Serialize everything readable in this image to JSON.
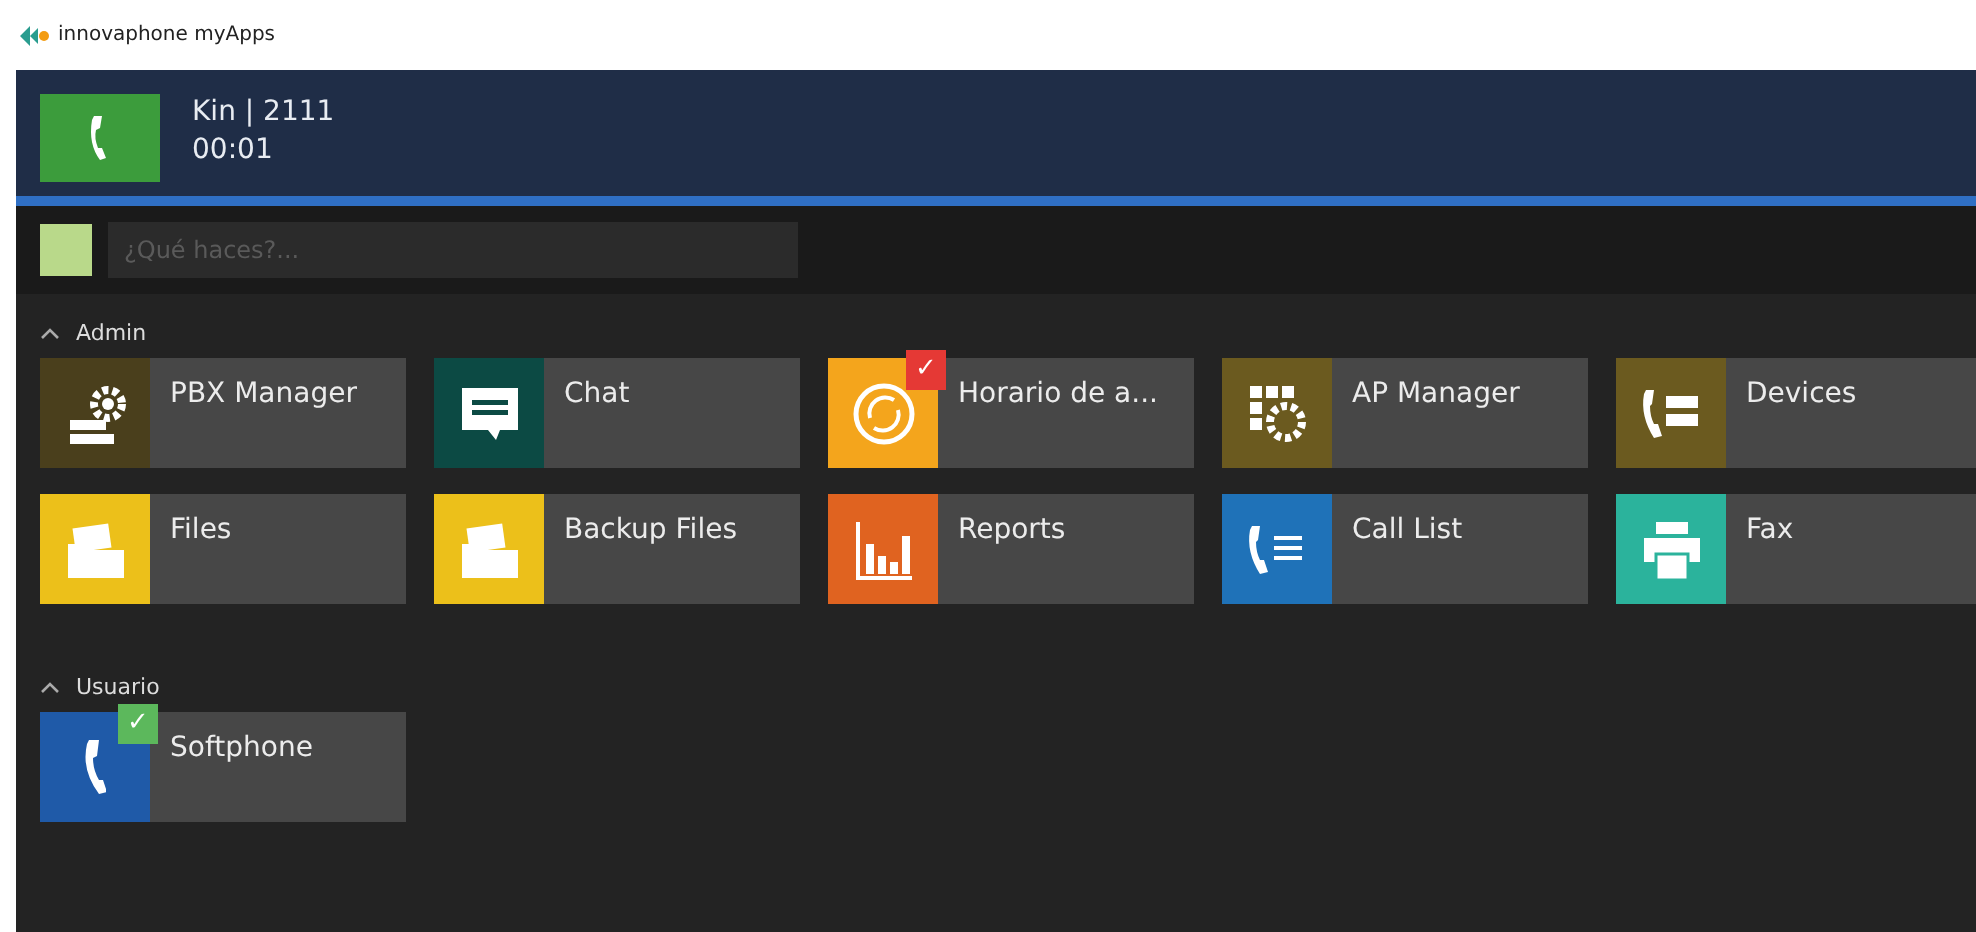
{
  "window": {
    "title": "innovaphone myApps"
  },
  "call": {
    "name": "Kin | 2111",
    "duration": "00:01"
  },
  "status": {
    "placeholder": "¿Qué haces?..."
  },
  "sections": [
    {
      "title": "Admin",
      "expanded": true,
      "apps": [
        {
          "label": "PBX Manager",
          "kind": "server-gear",
          "color": "#4a3f1c"
        },
        {
          "label": "Chat",
          "kind": "chat",
          "color": "#0c4a44"
        },
        {
          "label": "Horario de a...",
          "kind": "clock",
          "color": "#f4a51c",
          "badge": {
            "mark": "✓",
            "color": "#e53935"
          }
        },
        {
          "label": "AP Manager",
          "kind": "grid-gear",
          "color": "#6b5a1f"
        },
        {
          "label": "Devices",
          "kind": "phone-server",
          "color": "#6b5a1f"
        },
        {
          "label": "Files",
          "kind": "folder",
          "color": "#ecc01a"
        },
        {
          "label": "Backup Files",
          "kind": "folder",
          "color": "#ecc01a"
        },
        {
          "label": "Reports",
          "kind": "chart",
          "color": "#e06320"
        },
        {
          "label": "Call List",
          "kind": "phone-list",
          "color": "#1f72b8"
        },
        {
          "label": "Fax",
          "kind": "printer",
          "color": "#2bb39c"
        }
      ]
    },
    {
      "title": "Usuario",
      "expanded": true,
      "apps": [
        {
          "label": "Softphone",
          "kind": "phone",
          "color": "#1f5aa8",
          "badge": {
            "mark": "✓",
            "color": "#5cb85c"
          }
        }
      ]
    }
  ]
}
